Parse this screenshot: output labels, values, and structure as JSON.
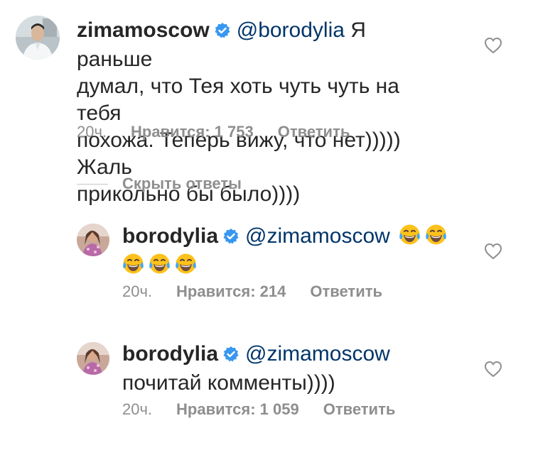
{
  "comments": [
    {
      "username": "zimamoscow",
      "mention": "@borodylia",
      "lines": [
        " Я раньше",
        "думал, что Тея хоть чуть чуть на тебя",
        "похожа. Теперь вижу, что нет))))) Жаль",
        "прикольно бы было))))"
      ],
      "time": "20ч.",
      "likes": "Нравится: 1 753",
      "reply": "Ответить"
    },
    {
      "username": "borodylia",
      "mention": "@zimamoscow",
      "line1": "",
      "line2": "",
      "emoji_icon": "face-with-tears-of-joy-icon",
      "emoji_count": 5,
      "time": "20ч.",
      "likes": "Нравится: 214",
      "reply": "Ответить"
    },
    {
      "username": "borodylia",
      "mention": "@zimamoscow",
      "line2": "почитай комменты))))",
      "time": "20ч.",
      "likes": "Нравится: 1 059",
      "reply": "Ответить"
    }
  ],
  "hide_replies": "Скрыть ответы",
  "colors": {
    "text": "#262626",
    "mention": "#003569",
    "meta": "#8e8e8e",
    "verified": "#3897f0"
  }
}
